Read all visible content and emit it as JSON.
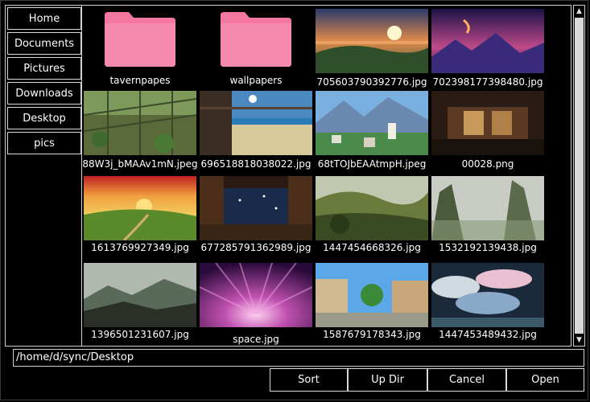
{
  "sidebar": {
    "items": [
      {
        "label": "Home"
      },
      {
        "label": "Documents"
      },
      {
        "label": "Pictures"
      },
      {
        "label": "Downloads"
      },
      {
        "label": "Desktop"
      },
      {
        "label": "pics"
      }
    ]
  },
  "files": [
    {
      "name": "tavernpapes",
      "type": "folder"
    },
    {
      "name": "wallpapers",
      "type": "folder"
    },
    {
      "name": "705603790392776.jpg",
      "type": "image",
      "scene": "sunset-coast"
    },
    {
      "name": "702398177398480.jpg",
      "type": "image",
      "scene": "purple-mountains"
    },
    {
      "name": "88W3j_bMAAv1mN.jpeg",
      "type": "image",
      "scene": "greenhouse"
    },
    {
      "name": "696518818038022.jpg",
      "type": "image",
      "scene": "beach-cafe"
    },
    {
      "name": "68tTOJbEAAtmpH.jpeg",
      "type": "image",
      "scene": "village-mountains"
    },
    {
      "name": "00028.png",
      "type": "image",
      "scene": "interior-dark"
    },
    {
      "name": "1613769927349.jpg",
      "type": "image",
      "scene": "red-sunset-hills"
    },
    {
      "name": "677285791362989.jpg",
      "type": "image",
      "scene": "night-interior"
    },
    {
      "name": "1447454668326.jpg",
      "type": "image",
      "scene": "valley-forest"
    },
    {
      "name": "1532192139438.jpg",
      "type": "image",
      "scene": "misty-cliffs"
    },
    {
      "name": "1396501231607.jpg",
      "type": "image",
      "scene": "foggy-hills"
    },
    {
      "name": "space.jpg",
      "type": "image",
      "scene": "purple-rays"
    },
    {
      "name": "1587679178343.jpg",
      "type": "image",
      "scene": "sunny-street"
    },
    {
      "name": "1447453489432.jpg",
      "type": "image",
      "scene": "cloud-sky"
    }
  ],
  "path": {
    "value": "/home/d/sync/Desktop"
  },
  "buttons": {
    "sort": "Sort",
    "updir": "Up Dir",
    "cancel": "Cancel",
    "open": "Open"
  },
  "colors": {
    "background": "#000000",
    "border": "#cfcfcf",
    "folder": "#f0789f",
    "scroll_thumb": "#d9d9d9"
  }
}
